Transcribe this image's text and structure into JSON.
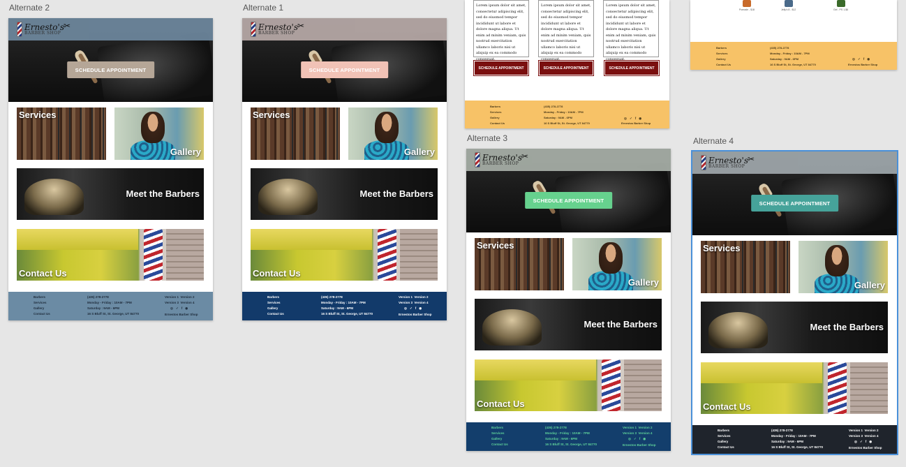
{
  "artboards": [
    {
      "key": "alt2",
      "label": "Alternate 2",
      "nav_bg": "#6e889e",
      "button_label": "SCHEDULE APPOINTMENT",
      "button_color": "#b5a697",
      "footer_bg": "#6b8ba4",
      "footer_text_color": "#1e2b3a"
    },
    {
      "key": "alt1",
      "label": "Alternate 1",
      "nav_bg": "#b8aaa8",
      "button_label": "SCHEDULE APPOINTMENT",
      "button_color": "#f1c2b6",
      "footer_bg": "#123a6a",
      "footer_text_color": "#ffffff"
    },
    {
      "key": "alt3",
      "label": "Alternate 3",
      "nav_bg": "#a8b0a8",
      "button_label": "SCHEDULE APPOINTMENT",
      "button_color": "#66d18e",
      "footer_bg": "#133e6c",
      "footer_text_color": "#5fd39a"
    },
    {
      "key": "alt4",
      "label": "Alternate 4",
      "nav_bg": "#a0a8ac",
      "button_label": "SCHEDULE APPOINTMENT",
      "button_color": "#46a39a",
      "footer_bg": "#1f242c",
      "footer_text_color": "#ffffff"
    }
  ],
  "logo": {
    "name": "Ernesto's",
    "sub": "BARBER SHOP"
  },
  "tiles": {
    "services": "Services",
    "gallery": "Gallery",
    "barbers": "Meet the Barbers",
    "contact": "Contact Us"
  },
  "footer": {
    "links": [
      "Barbers",
      "Services",
      "Gallery",
      "Contact Us"
    ],
    "phone": "(435) 278-2778",
    "hours1": "Monday - Friday : 10AM - 7PM",
    "hours2": "Saturday : 9AM - 6PM",
    "address": "16 S Bluff St, St. George, UT 84770",
    "version1": "Version 1",
    "version2": "Version 2",
    "version3": "Version 3",
    "version4": "Version 4",
    "social": [
      "◎",
      "✓",
      "f",
      "◉"
    ],
    "brand": "Ernestos Barber Shop"
  },
  "partial_top": {
    "lorem": "Lorem ipsum dolor sit amet, consectetur adipiscing elit, sed do eiusmod tempor incididunt ut labore et dolore magna aliqua. Ut enim ad minim veniam, quis nostrud exercitation ullamco laboris nisi ut aliquip ex ea commodo consequat.",
    "button": "SCHEDULE APPOINTMENT",
    "products": [
      "Pomade - $18",
      "Jelly's 8 - $12",
      "Gel - PS 1-$6"
    ]
  }
}
